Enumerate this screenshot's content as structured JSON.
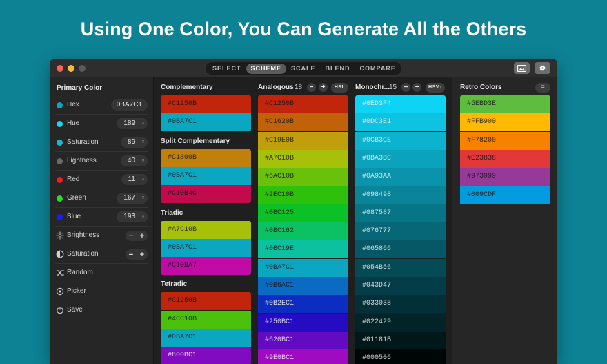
{
  "headline": "Using One Color, You Can Generate All the Others",
  "window": {
    "traffic_lights": [
      "#ff5f57",
      "#febc2e",
      "#5a5a5a"
    ],
    "tabs": [
      {
        "label": "SELECT",
        "active": false
      },
      {
        "label": "SCHEME",
        "active": true
      },
      {
        "label": "SCALE",
        "active": false
      },
      {
        "label": "BLEND",
        "active": false
      },
      {
        "label": "COMPARE",
        "active": false
      }
    ],
    "toolbar_icons": [
      "image-icon",
      "gear-icon"
    ]
  },
  "sidebar": {
    "title": "Primary Color",
    "rows": [
      {
        "label": "Hex",
        "value": "0BA7C1",
        "dot": "#0ba7c1",
        "kind": "text"
      },
      {
        "label": "Hue",
        "value": "189",
        "dot": "#1ad6f0",
        "kind": "num"
      },
      {
        "label": "Saturation",
        "value": "89",
        "dot": "#16b8d6",
        "kind": "num"
      },
      {
        "label": "Lightness",
        "value": "40",
        "dot": "#6a6a6a",
        "kind": "num"
      },
      {
        "label": "Red",
        "value": "11",
        "dot": "#ff1a1a",
        "kind": "num"
      },
      {
        "label": "Green",
        "value": "167",
        "dot": "#20e020",
        "kind": "num"
      },
      {
        "label": "Blue",
        "value": "193",
        "dot": "#1a1aff",
        "kind": "num"
      }
    ],
    "actions": [
      {
        "label": "Brightness",
        "icon": "brightness-icon",
        "stepper": true
      },
      {
        "label": "Saturation",
        "icon": "contrast-icon",
        "stepper": true
      },
      {
        "label": "Random",
        "icon": "shuffle-icon",
        "stepper": false
      },
      {
        "label": "Picker",
        "icon": "target-icon",
        "stepper": false
      },
      {
        "label": "Save",
        "icon": "power-icon",
        "stepper": false
      }
    ]
  },
  "schemes": {
    "title": "Complementary",
    "groups": [
      {
        "title": "Complementary",
        "swatches": [
          {
            "hex": "#C1250B",
            "text": "dark"
          },
          {
            "hex": "#0BA7C1",
            "text": "dark",
            "selected": true
          }
        ]
      },
      {
        "title": "Split Complementary",
        "swatches": [
          {
            "hex": "#C1800B",
            "text": "dark"
          },
          {
            "hex": "#0BA7C1",
            "text": "dark",
            "selected": true
          },
          {
            "hex": "#C10B4C",
            "text": "dark"
          }
        ]
      },
      {
        "title": "Triadic",
        "swatches": [
          {
            "hex": "#A7C10B",
            "text": "dark"
          },
          {
            "hex": "#0BA7C1",
            "text": "dark",
            "selected": true
          },
          {
            "hex": "#C10BA7",
            "text": "dark"
          }
        ]
      },
      {
        "title": "Tetradic",
        "swatches": [
          {
            "hex": "#C1250B",
            "text": "dark"
          },
          {
            "hex": "#4CC10B",
            "text": "dark"
          },
          {
            "hex": "#0BA7C1",
            "text": "dark",
            "selected": true
          },
          {
            "hex": "#800BC1",
            "text": "light"
          }
        ]
      }
    ]
  },
  "analogous": {
    "title": "Analogous",
    "count": "18",
    "mode": "HSL",
    "swatches": [
      "#C1250B",
      "#C1620B",
      "#C19E0B",
      "#A7C10B",
      "#6AC10B",
      "#2EC10B",
      "#0BC125",
      "#0BC162",
      "#0BC19E",
      "#0BA7C1",
      "#0B6AC1",
      "#0B2EC1",
      "#250BC1",
      "#620BC1",
      "#9E0BC1"
    ],
    "selected": 9
  },
  "monochrome": {
    "title": "Monochr...",
    "count": "15",
    "mode": "HSV↕",
    "swatches": [
      "#0ED3F4",
      "#0DC3E1",
      "#0CB3CE",
      "#0BA3BC",
      "#0A93AA",
      "#098498",
      "#087587",
      "#076777",
      "#065866",
      "#054B56",
      "#043D47",
      "#033038",
      "#022429",
      "#01181B",
      "#000506"
    ],
    "selected": 3
  },
  "retro": {
    "title": "Retro Colors",
    "menu_icon": "menu-icon",
    "swatches": [
      "#5EBD3E",
      "#FFB900",
      "#F78200",
      "#E23838",
      "#973999",
      "#009CDF"
    ]
  }
}
